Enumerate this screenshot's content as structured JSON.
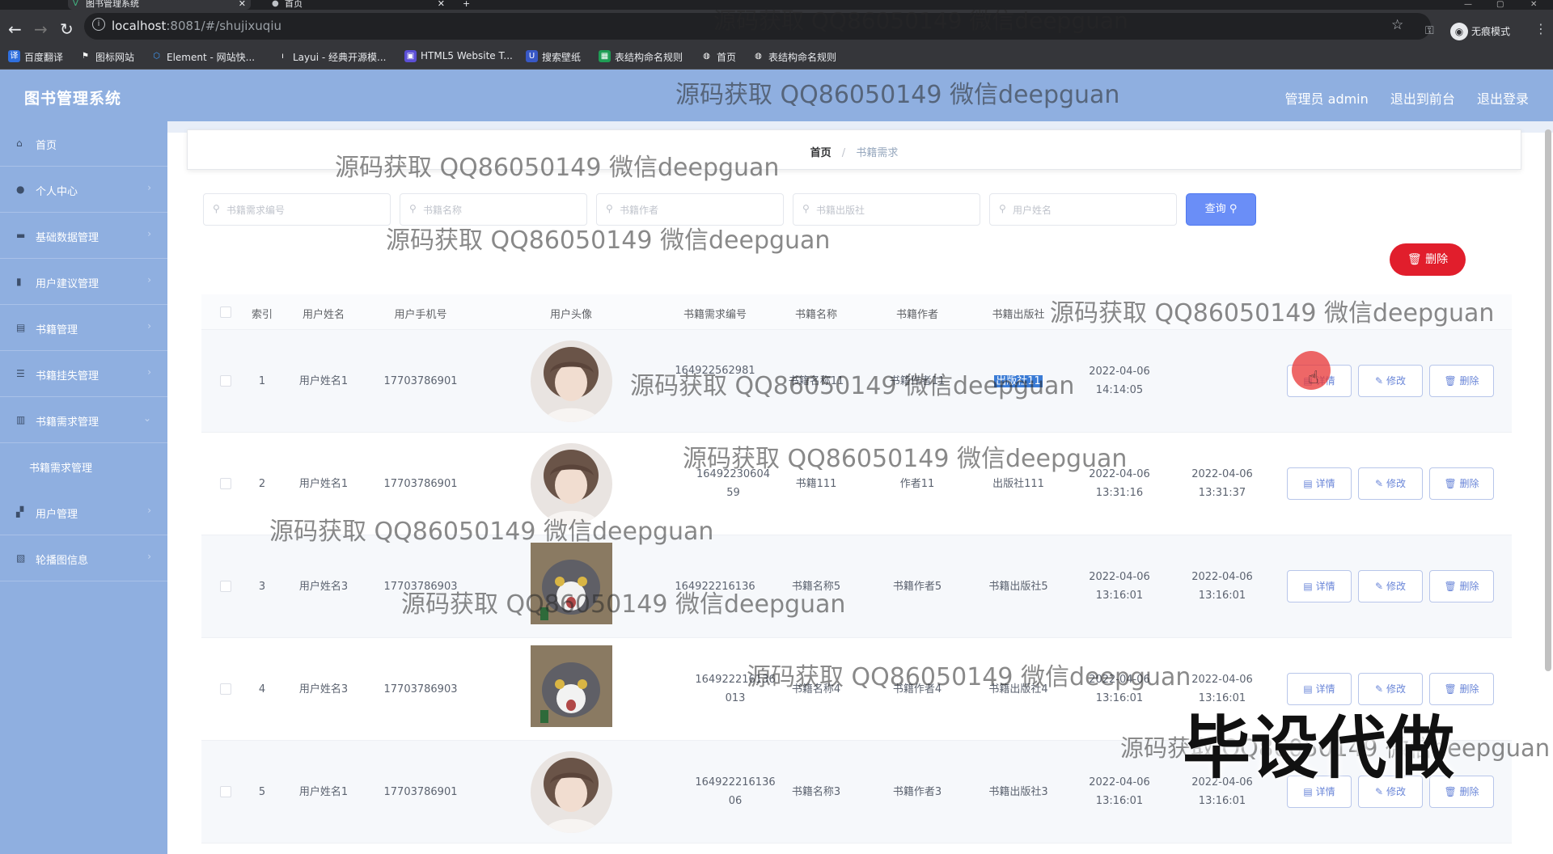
{
  "browser": {
    "tabs": [
      {
        "label": "图书管理系统",
        "active": true
      },
      {
        "label": "首页",
        "active": false
      }
    ],
    "new_tab": "+",
    "url_host": "localhost",
    "url_rest": ":8081/#/shujixuqiu",
    "incognito_label": "无痕模式",
    "bookmarks": [
      {
        "label": "百度翻译",
        "icon": "translate-icon"
      },
      {
        "label": "图标网站",
        "icon": "flag-icon"
      },
      {
        "label": "Element - 网站快...",
        "icon": "element-icon"
      },
      {
        "label": "Layui - 经典开源模...",
        "icon": "layui-icon"
      },
      {
        "label": "HTML5 Website T...",
        "icon": "html5-icon"
      },
      {
        "label": "搜索壁纸",
        "icon": "wallpaper-icon"
      },
      {
        "label": "表结构命名规则",
        "icon": "table-icon"
      },
      {
        "label": "首页",
        "icon": "globe-icon"
      },
      {
        "label": "表结构命名规则",
        "icon": "globe-icon"
      }
    ]
  },
  "header": {
    "title": "图书管理系统",
    "admin": "管理员 admin",
    "to_front": "退出到前台",
    "logout": "退出登录"
  },
  "sidebar": {
    "items": [
      {
        "label": "首页",
        "icon": "home-icon"
      },
      {
        "label": "个人中心",
        "icon": "user-icon"
      },
      {
        "label": "基础数据管理",
        "icon": "data-icon"
      },
      {
        "label": "用户建议管理",
        "icon": "chart-icon"
      },
      {
        "label": "书籍管理",
        "icon": "book-icon"
      },
      {
        "label": "书籍挂失管理",
        "icon": "list-icon"
      },
      {
        "label": "书籍需求管理",
        "icon": "demand-icon"
      },
      {
        "label": "用户管理",
        "icon": "users-icon"
      },
      {
        "label": "轮播图信息",
        "icon": "image-icon"
      }
    ],
    "sub_item": "书籍需求管理"
  },
  "breadcrumb": {
    "home": "首页",
    "sep": "/",
    "current": "书籍需求"
  },
  "search": {
    "placeholders": [
      "书籍需求编号",
      "书籍名称",
      "书籍作者",
      "书籍出版社",
      "用户姓名"
    ],
    "query_label": "查询",
    "delete_label": "删除"
  },
  "table": {
    "headers": [
      "索引",
      "用户姓名",
      "用户手机号",
      "用户头像",
      "书籍需求编号",
      "书籍名称",
      "书籍作者",
      "书籍出版社",
      "",
      "",
      ""
    ],
    "rows": [
      {
        "index": "1",
        "name": "用户姓名1",
        "phone": "17703786901",
        "avatar": "girl",
        "code": "164922562981",
        "book": "书籍名称11",
        "author": "书籍作者11",
        "publisher": "出版社11",
        "created": "2022-04-06 14:14:05",
        "updated": ""
      },
      {
        "index": "2",
        "name": "用户姓名1",
        "phone": "17703786901",
        "avatar": "girl",
        "code": "1649223060459",
        "book": "书籍111",
        "author": "作者11",
        "publisher": "出版社111",
        "created": "2022-04-06 13:31:16",
        "updated": "2022-04-06 13:31:37"
      },
      {
        "index": "3",
        "name": "用户姓名3",
        "phone": "17703786903",
        "avatar": "cat",
        "code": "164922216136",
        "book": "书籍名称5",
        "author": "书籍作者5",
        "publisher": "书籍出版社5",
        "created": "2022-04-06 13:16:01",
        "updated": "2022-04-06 13:16:01"
      },
      {
        "index": "4",
        "name": "用户姓名3",
        "phone": "17703786903",
        "avatar": "cat",
        "code": "164922216136013",
        "book": "书籍名称4",
        "author": "书籍作者4",
        "publisher": "书籍出版社4",
        "created": "2022-04-06 13:16:01",
        "updated": "2022-04-06 13:16:01"
      },
      {
        "index": "5",
        "name": "用户姓名1",
        "phone": "17703786901",
        "avatar": "girl",
        "code": "16492221613606",
        "book": "书籍名称3",
        "author": "书籍作者3",
        "publisher": "书籍出版社3",
        "created": "2022-04-06 13:16:01",
        "updated": "2022-04-06 13:16:01"
      }
    ],
    "ops": {
      "detail": "详情",
      "edit": "修改",
      "delete": "删除"
    }
  },
  "overlays": {
    "watermark": "源码获取 QQ86050149 微信deepguan",
    "stamp": "毕设代做"
  },
  "colors": {
    "primary": "#6a8ef7",
    "danger": "#e11e2c",
    "header_bg": "#8fafe0"
  }
}
